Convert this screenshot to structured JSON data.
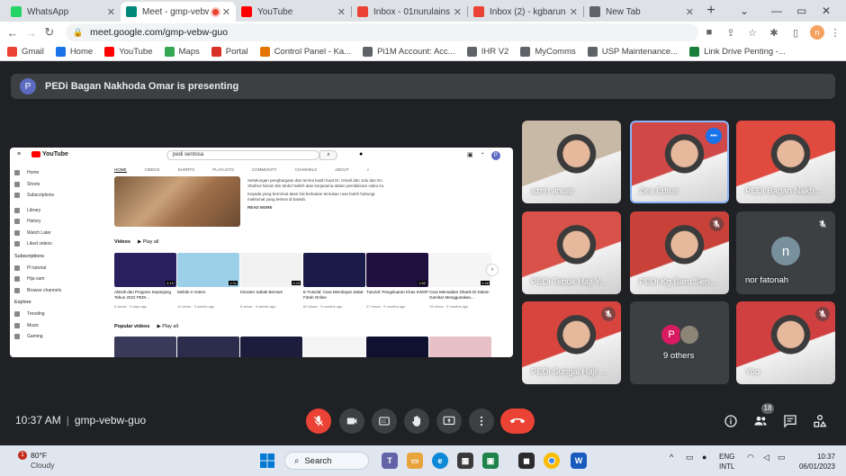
{
  "browser": {
    "tabs": [
      {
        "label": "WhatsApp",
        "icon": "whatsapp-icon",
        "color": "#25d366"
      },
      {
        "label": "Meet - gmp-vebw",
        "icon": "meet-icon",
        "color": "#00897b",
        "active": true
      },
      {
        "label": "YouTube",
        "icon": "youtube-icon",
        "color": "#ff0000"
      },
      {
        "label": "Inbox - 01nurulainsya",
        "icon": "gmail-icon",
        "color": "#ea4335"
      },
      {
        "label": "Inbox (2) - kgbarunela",
        "icon": "gmail-icon",
        "color": "#ea4335"
      },
      {
        "label": "New Tab",
        "icon": "chrome-icon",
        "color": "#5f6368"
      }
    ],
    "new_tab": "+",
    "url": "meet.google.com/gmp-vebw-guo",
    "profile_initial": "n",
    "bookmarks": [
      {
        "label": "Gmail",
        "color": "#ea4335"
      },
      {
        "label": "Home",
        "color": "#1a73e8"
      },
      {
        "label": "YouTube",
        "color": "#ff0000"
      },
      {
        "label": "Maps",
        "color": "#34a853"
      },
      {
        "label": "Portal",
        "color": "#d93025"
      },
      {
        "label": "Control Panel - Ka...",
        "color": "#e37400"
      },
      {
        "label": "Pi1M Account: Acc...",
        "color": "#5f6368"
      },
      {
        "label": "IHR V2",
        "color": "#5f6368"
      },
      {
        "label": "MyComms",
        "color": "#5f6368"
      },
      {
        "label": "USP Maintenance...",
        "color": "#5f6368"
      },
      {
        "label": "Link Drive Penting -...",
        "color": "#188038"
      }
    ]
  },
  "meet": {
    "presenting_initial": "P",
    "presenting_text": "PEDi Bagan Nakhoda Omar is presenting",
    "meeting_time": "10:37 AM",
    "meeting_code": "gmp-vebw-guo",
    "participants_count": "18",
    "participants": [
      {
        "name": "azrin anuar",
        "muted": false,
        "bg": "#c8b8a6"
      },
      {
        "name": "Zea Edrus",
        "muted": false,
        "bg": "#d04848",
        "selected": true
      },
      {
        "name": "PEDi Bagan Nakh...",
        "muted": false,
        "bg": "#e04a3f"
      },
      {
        "name": "PEDi Tebuk Haji Y...",
        "muted": false,
        "bg": "#d9524a"
      },
      {
        "name": "PEDi Kg Baru Sen...",
        "muted": true,
        "bg": "#c9423a"
      },
      {
        "name": "nor fatonah",
        "muted": true,
        "bg": "#3c4043",
        "initial": "n"
      },
      {
        "name": "PEDi Sungai Haji ...",
        "muted": true,
        "bg": "#d8453e"
      },
      {
        "name": "9 others",
        "muted": false,
        "bg": "#3c4043",
        "initial": "P"
      },
      {
        "name": "You",
        "muted": true,
        "bg": "#d04040"
      }
    ]
  },
  "youtube": {
    "search": "pedi sentosa",
    "logo": "YouTube",
    "sidebar": [
      "Home",
      "Shorts",
      "Subscriptions",
      "Library",
      "History",
      "Watch Later",
      "Liked videos"
    ],
    "subscriptions_label": "Subscriptions",
    "subs": [
      "PI tutorial",
      "Hija sam",
      "Browse channels"
    ],
    "explore_label": "Explore",
    "explore": [
      "Trending",
      "Music",
      "Gaming"
    ],
    "tabs": [
      "HOME",
      "VIDEOS",
      "SHORTS",
      "PLAYLISTS",
      "COMMUNITY",
      "CHANNELS",
      "ABOUT"
    ],
    "description": "Sekalungan penghargaan dan terima kasih buat Dr. Ismail dan Julu dan En. Shahrul Nizam Bin Mohd Salleh atas kerjasama dalam pembikinan video ini.",
    "description2": "Kepada yang berminat akan hal berkaitan tentukan ruas boleh hubungi maklumat yang tertera di bawah.",
    "read_more": "READ MORE",
    "videos_label": "Videos",
    "play_all": "Play all",
    "videos": [
      {
        "title": "Aktiviti dan Program Sepanjang Tahun 2022 PEDI...",
        "meta": "5 views · 3 days ago",
        "dur": "4:10",
        "bg": "#2a2060"
      },
      {
        "title": "Mobile e-Voters",
        "meta": "11 views · 3 weeks ago",
        "dur": "1:31",
        "bg": "#9bd0e8"
      },
      {
        "title": "Klusster Sabak Bernam",
        "meta": "8 views · 3 weeks ago",
        "dur": "0:43",
        "bg": "#f2f2f2"
      },
      {
        "title": "E-Tutorial: Cara Membayar Zakat Fitrah Online",
        "meta": "62 views · 9 months ago",
        "dur": "",
        "bg": "#1b1b4a"
      },
      {
        "title": "Tutorial: Pengeluaran Khas KWSP",
        "meta": "27 views · 9 months ago",
        "dur": "1:52",
        "bg": "#201040"
      },
      {
        "title": "Cara Memadam Gbank Di Dalam Gambar Menggunakan...",
        "meta": "15 views · 9 months ago",
        "dur": "0:48",
        "bg": "#f5f5f5"
      }
    ],
    "popular_label": "Popular videos",
    "popular": [
      {
        "bg": "#3a3a5a"
      },
      {
        "bg": "#2c2c4c"
      },
      {
        "bg": "#1c1c3c"
      },
      {
        "bg": "#f5f5f5"
      },
      {
        "bg": "#101030"
      },
      {
        "bg": "#e8c0c8"
      }
    ]
  },
  "taskbar": {
    "weather_temp": "80°F",
    "weather_text": "Cloudy",
    "weather_badge": "1",
    "search_label": "Search",
    "lang_top": "ENG",
    "lang_bottom": "INTL",
    "time": "10:37",
    "date": "06/01/2023"
  }
}
